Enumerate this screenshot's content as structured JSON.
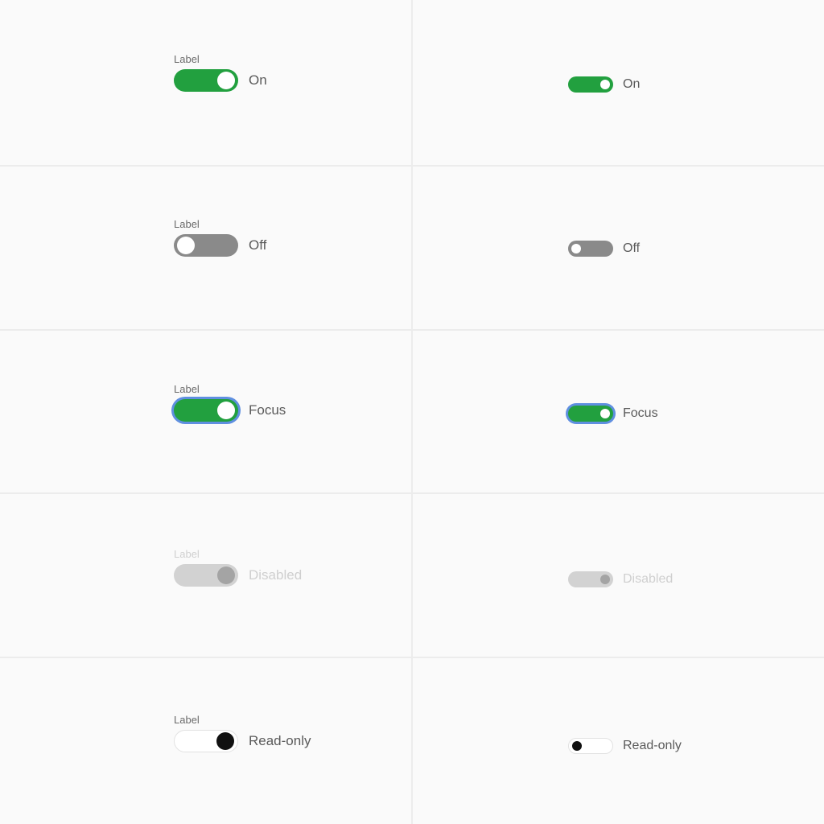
{
  "field_label": "Label",
  "colors": {
    "on": "#22a03f",
    "off": "#8a8a8a",
    "focus_ring": "#5f8fe0",
    "disabled_track": "#d2d2d2",
    "readonly_knob": "#111111"
  },
  "rows": [
    {
      "state": "on",
      "text": "On",
      "checked": true
    },
    {
      "state": "off",
      "text": "Off",
      "checked": false
    },
    {
      "state": "focus",
      "text": "Focus",
      "checked": true
    },
    {
      "state": "disabled",
      "text": "Disabled",
      "checked": true
    },
    {
      "state": "readonly",
      "text": "Read-only",
      "checked": true
    }
  ],
  "small_rows": [
    {
      "state": "on",
      "text": "On",
      "checked": true
    },
    {
      "state": "off",
      "text": "Off",
      "checked": false
    },
    {
      "state": "focus",
      "text": "Focus",
      "checked": true
    },
    {
      "state": "disabled",
      "text": "Disabled",
      "checked": true
    },
    {
      "state": "readonly",
      "text": "Read-only",
      "checked": false
    }
  ]
}
